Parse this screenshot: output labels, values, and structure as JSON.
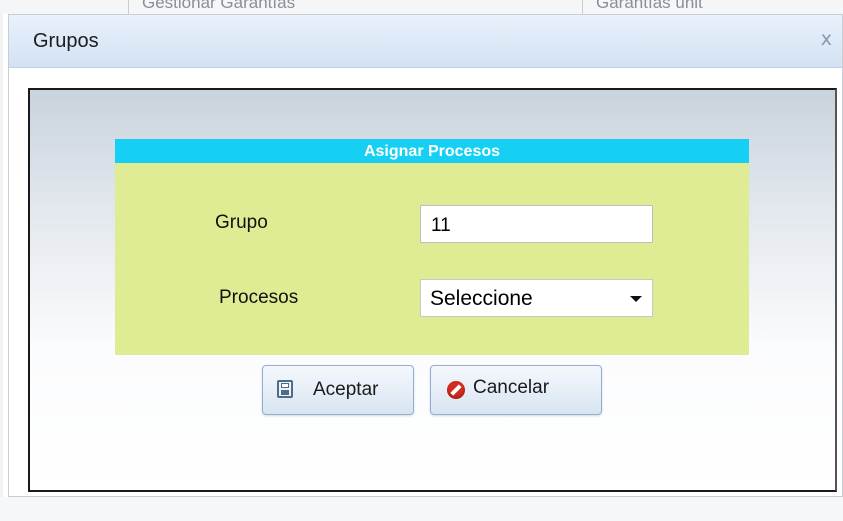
{
  "background": {
    "tab_left": "Gestionar Garantías",
    "tab_right": "Garantías unit"
  },
  "dialog": {
    "title": "Grupos",
    "close": "x"
  },
  "panel": {
    "header": "Asignar Procesos",
    "grupo_label": "Grupo",
    "grupo_value": "11",
    "procesos_label": "Procesos",
    "procesos_selected": "Seleccione"
  },
  "buttons": {
    "accept_label": "Aceptar",
    "cancel_label": "Cancelar"
  },
  "colors": {
    "panel_header": "#15d0f2",
    "panel_body": "#e0ec93",
    "titlebar": "#d3e2f4",
    "cancel_icon": "#d52b1e"
  },
  "icons": {
    "accept": "save-icon",
    "cancel": "cancel-icon",
    "select": "chevron-down-icon"
  }
}
